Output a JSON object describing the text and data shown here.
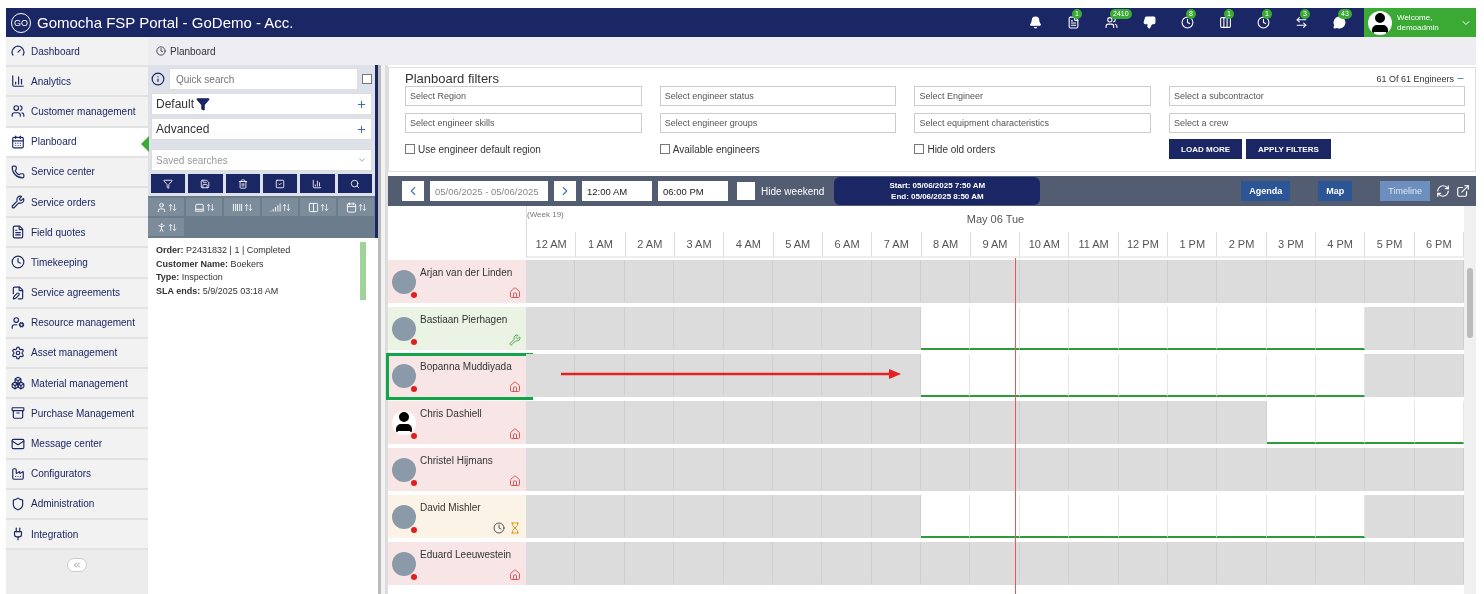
{
  "window": {
    "title": "Gomocha FSP Portal - GoDemo - Acc.",
    "logo": "GO"
  },
  "header_icons": [
    {
      "kind": "bell"
    },
    {
      "kind": "document",
      "badge": "1"
    },
    {
      "kind": "people",
      "badge": "2410"
    },
    {
      "kind": "thumbs-down"
    },
    {
      "kind": "clock",
      "badge": "8"
    },
    {
      "kind": "columns",
      "badge": "1"
    },
    {
      "kind": "clock",
      "badge": "1"
    },
    {
      "kind": "transfer",
      "badge": "3"
    },
    {
      "kind": "chat",
      "badge": "43"
    }
  ],
  "user": {
    "greeting": "Welcome,",
    "name": "demoadmin"
  },
  "sidebar": {
    "items": [
      {
        "label": "Dashboard",
        "selected": false
      },
      {
        "label": "Analytics",
        "selected": false
      },
      {
        "label": "Customer management",
        "selected": false
      },
      {
        "label": "Planboard",
        "selected": true
      },
      {
        "label": "Service center",
        "selected": false
      },
      {
        "label": "Service orders",
        "selected": false
      },
      {
        "label": "Field quotes",
        "selected": false
      },
      {
        "label": "Timekeeping",
        "selected": false
      },
      {
        "label": "Service agreements",
        "selected": false
      },
      {
        "label": "Resource management",
        "selected": false
      },
      {
        "label": "Asset management",
        "selected": false
      },
      {
        "label": "Material management",
        "selected": false
      },
      {
        "label": "Purchase Management",
        "selected": false
      },
      {
        "label": "Message center",
        "selected": false
      },
      {
        "label": "Configurators",
        "selected": false
      },
      {
        "label": "Administration",
        "selected": false
      },
      {
        "label": "Integration",
        "selected": false
      }
    ]
  },
  "breadcrumb": "Planboard",
  "order_panel": {
    "search": {
      "placeholder": "Quick search"
    },
    "select_all": {
      "checked": false
    },
    "sections": [
      {
        "label": "Default",
        "kind": "filter"
      },
      {
        "label": "Advanced",
        "kind": "plain"
      }
    ],
    "saved_searches": {
      "placeholder": "Saved searches"
    },
    "order_card": {
      "lines": [
        "**Order:** P2431832 | 1 | Completed",
        "**Customer Name:** Boekers",
        "**Type:** Inspection",
        "**SLA ends:** 5/9/2025 03:18 AM"
      ]
    }
  },
  "filters": {
    "title": "Planboard filters",
    "count": "61 Of 61 Engineers",
    "selects": [
      "Select Region",
      "Select engineer status",
      "Select Engineer",
      "Select a subcontractor",
      "Select engineer skills",
      "Select engineer groups",
      "Select equipment characteristics",
      "Select a crew"
    ],
    "options": [
      {
        "label": "Use engineer default region",
        "checked": false
      },
      {
        "label": "Available engineers",
        "checked": false
      },
      {
        "label": "Hide old orders",
        "checked": false
      }
    ],
    "buttons": [
      "LOAD MORE",
      "APPLY FILTERS"
    ]
  },
  "toolbar": {
    "date_range": "05/06/2025 - 05/06/2025",
    "start_time": "12:00 AM",
    "end_time": "06:00 PM",
    "hide_weekend": {
      "label": "Hide weekend",
      "checked": false
    },
    "selection": [
      "Start: 05/06/2025 7:50 AM",
      "End: 05/06/2025 8:50 AM"
    ],
    "views": [
      {
        "label": "Agenda",
        "selected": false
      },
      {
        "label": "Map",
        "selected": false
      },
      {
        "label": "Timeline",
        "selected": true
      }
    ]
  },
  "timeline": {
    "week": "(Week 19)",
    "day": "May 06 Tue",
    "hours": [
      "12 AM",
      "1 AM",
      "2 AM",
      "3 AM",
      "4 AM",
      "5 AM",
      "6 AM",
      "7 AM",
      "8 AM",
      "9 AM",
      "10 AM",
      "11 AM",
      "12 PM",
      "1 PM",
      "2 PM",
      "3 PM",
      "4 PM",
      "5 PM",
      "6 PM"
    ],
    "now_line": {
      "level": 0.521
    },
    "engineers": [
      {
        "name": "Arjan van der Linden",
        "avatar": {
          "kind": "photo"
        },
        "color": "#f8e6e6",
        "status": {
          "color": "#e02020"
        },
        "icons": [
          {
            "kind": "home"
          }
        ],
        "highlighted": false,
        "slots": [
          false,
          false,
          false,
          false,
          false,
          false,
          false,
          false,
          false,
          false,
          false,
          false,
          false,
          false,
          false,
          false,
          false,
          false,
          false
        ]
      },
      {
        "name": "Bastiaan Pierhagen",
        "avatar": {
          "kind": "photo"
        },
        "color": "#eaf3e4",
        "status": {
          "color": "#e02020"
        },
        "icons": [
          {
            "kind": "tools"
          }
        ],
        "highlighted": false,
        "slots": [
          false,
          false,
          false,
          false,
          false,
          false,
          false,
          false,
          true,
          true,
          true,
          true,
          true,
          true,
          true,
          true,
          true,
          false,
          false
        ]
      },
      {
        "name": "Bopanna Muddiyada",
        "avatar": {
          "kind": "photo"
        },
        "color": "#f8e6e6",
        "status": {
          "color": "#e02020"
        },
        "icons": [
          {
            "kind": "home"
          }
        ],
        "highlighted": true,
        "slots": [
          false,
          false,
          false,
          false,
          false,
          false,
          false,
          false,
          true,
          true,
          true,
          true,
          true,
          true,
          true,
          true,
          true,
          false,
          false
        ]
      },
      {
        "name": "Chris Dashiell",
        "avatar": {
          "kind": "silhouette"
        },
        "color": "#f8e6e6",
        "status": {
          "color": "#e02020"
        },
        "icons": [
          {
            "kind": "home"
          }
        ],
        "highlighted": false,
        "slots": [
          false,
          false,
          false,
          false,
          false,
          false,
          false,
          false,
          false,
          false,
          false,
          false,
          false,
          false,
          false,
          true,
          true,
          true,
          true
        ]
      },
      {
        "name": "Christel Hijmans",
        "avatar": {
          "kind": "photo"
        },
        "color": "#f8e6e6",
        "status": {
          "color": "#e02020"
        },
        "icons": [
          {
            "kind": "home"
          }
        ],
        "highlighted": false,
        "slots": [
          false,
          false,
          false,
          false,
          false,
          false,
          false,
          false,
          false,
          false,
          false,
          false,
          false,
          false,
          false,
          false,
          false,
          false,
          false
        ]
      },
      {
        "name": "David Mishler",
        "avatar": {
          "kind": "photo"
        },
        "color": "#faf3e6",
        "status": {
          "color": "#e02020"
        },
        "icons": [
          {
            "kind": "clock"
          },
          {
            "kind": "hourglass"
          }
        ],
        "highlighted": false,
        "slots": [
          false,
          false,
          false,
          false,
          false,
          false,
          false,
          false,
          true,
          true,
          true,
          true,
          true,
          true,
          true,
          true,
          true,
          false,
          false
        ]
      },
      {
        "name": "Eduard Leeuwestein",
        "avatar": {
          "kind": "photo"
        },
        "color": "#f8e6e6",
        "status": {
          "color": "#e02020"
        },
        "icons": [
          {
            "kind": "home"
          }
        ],
        "highlighted": false,
        "slots": [
          false,
          false,
          false,
          false,
          false,
          false,
          false,
          false,
          false,
          false,
          false,
          false,
          false,
          false,
          false,
          false,
          false,
          false,
          false
        ]
      }
    ]
  }
}
